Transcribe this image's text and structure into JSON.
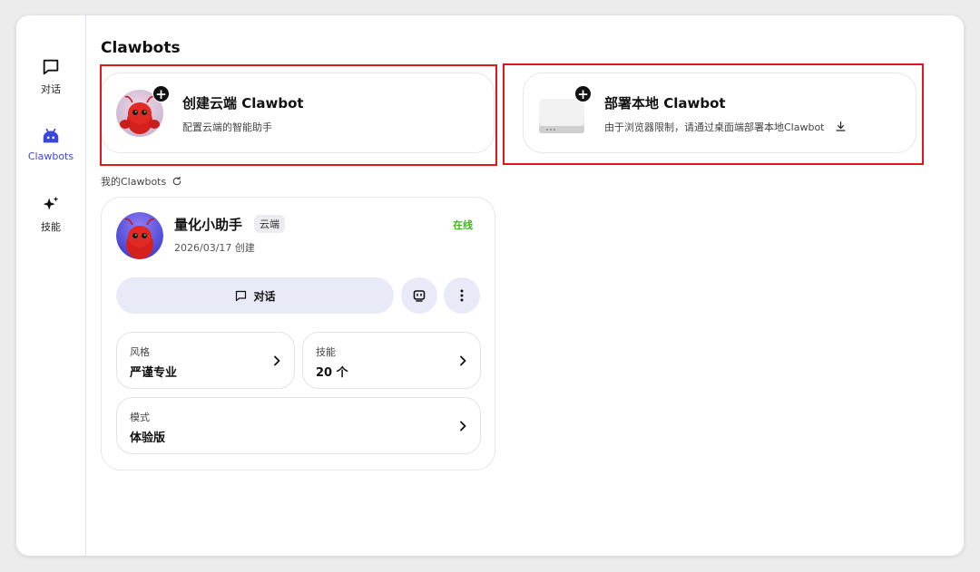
{
  "sidebar": {
    "items": [
      {
        "label": "对话",
        "icon": "chat-bubble-icon"
      },
      {
        "label": "Clawbots",
        "icon": "android-robot-icon",
        "active": true
      },
      {
        "label": "技能",
        "icon": "sparkles-icon"
      }
    ]
  },
  "page": {
    "title": "Clawbots"
  },
  "cards": {
    "cloud": {
      "title": "创建云端 Clawbot",
      "subtitle": "配置云端的智能助手",
      "badge": "+"
    },
    "local": {
      "title": "部署本地 Clawbot",
      "subtitle": "由于浏览器限制，请通过桌面端部署本地Clawbot",
      "badge": "+"
    }
  },
  "section": {
    "label": "我的Clawbots"
  },
  "bot": {
    "name": "量化小助手",
    "tag": "云端",
    "date": "2026/03/17 创建",
    "status": "在线",
    "chat_label": "对话",
    "settings": [
      {
        "label": "风格",
        "value": "严谨专业"
      },
      {
        "label": "技能",
        "value": "20 个"
      },
      {
        "label": "模式",
        "value": "体验版"
      }
    ]
  },
  "colors": {
    "accent": "#3b47d6",
    "online": "#3fb520",
    "highlight": "#e0161b"
  }
}
